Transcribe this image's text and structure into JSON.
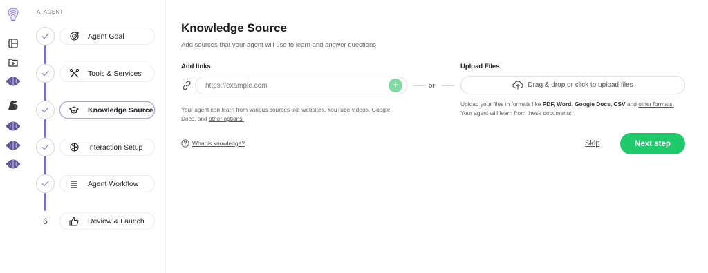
{
  "wizard": {
    "title": "AI AGENT",
    "steps": [
      {
        "label": "Agent Goal",
        "status": "done",
        "icon": "target-icon"
      },
      {
        "label": "Tools & Services",
        "status": "done",
        "icon": "tools-icon"
      },
      {
        "label": "Knowledge Source",
        "status": "active",
        "icon": "graduation-cap-icon"
      },
      {
        "label": "Interaction Setup",
        "status": "done",
        "icon": "interaction-icon"
      },
      {
        "label": "Agent Workflow",
        "status": "done",
        "icon": "workflow-icon"
      },
      {
        "label": "Review & Launch",
        "status": "pending",
        "number": "6",
        "icon": "thumbs-up-icon"
      }
    ]
  },
  "rail": {
    "icons": [
      "brain-logo-icon",
      "dashboard-icon",
      "add-folder-icon",
      "agent-brain-icon",
      "muscle-arm-icon",
      "agent-brain-icon",
      "agent-brain-icon",
      "agent-brain-icon"
    ]
  },
  "main": {
    "title": "Knowledge Source",
    "subtitle": "Add sources that your agent will use to learn and answer questions",
    "links": {
      "label": "Add links",
      "placeholder": "https://example.com",
      "add_label": "+",
      "help_text": "Your agent can learn from various sources like websites, YouTube videos, Google Docs, and ",
      "help_link": "other options."
    },
    "or_label": "or",
    "upload": {
      "label": "Upload Files",
      "button_label": "Drag & drop or click to upload files",
      "help_prefix": "Upload your files in formats like ",
      "formats": "PDF, Word, Google Docs, CSV",
      "help_and": " and ",
      "help_link": "other formats.",
      "help_suffix": "Your agent will learn from these documents."
    },
    "what_is_link": "What is knowledge?",
    "skip_label": "Skip",
    "next_label": "Next step"
  },
  "colors": {
    "accent_purple": "#7c6bc8",
    "primary_green": "#1fca6b",
    "add_green": "#7fd9a3"
  }
}
